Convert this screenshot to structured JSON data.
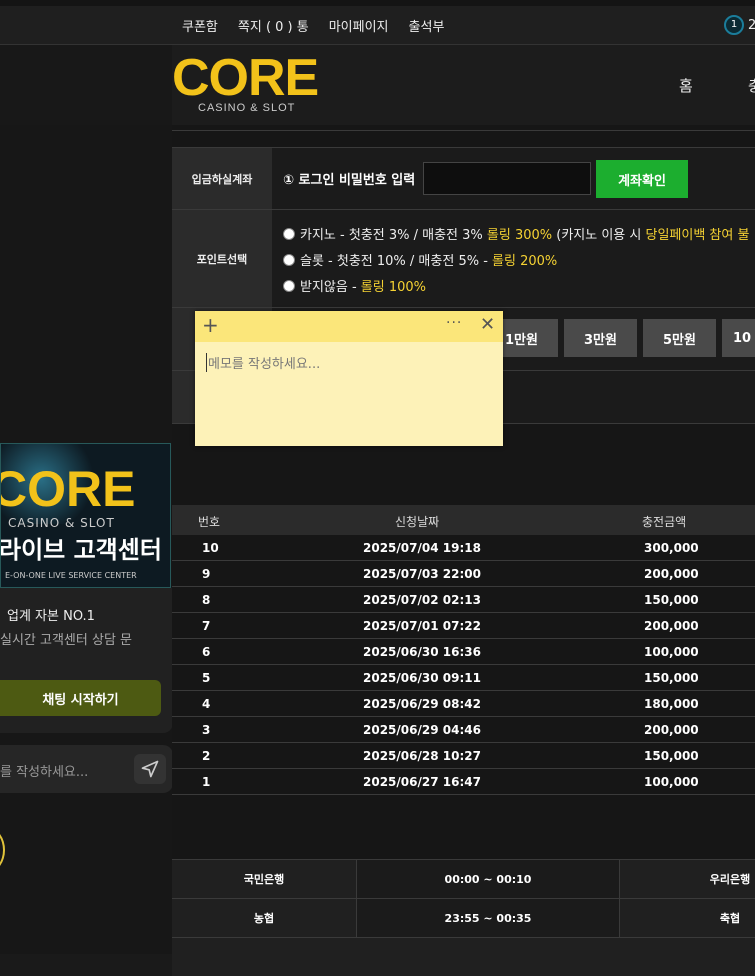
{
  "topnav": {
    "items": [
      "쿠폰함",
      "쪽지 ( 0 ) 통",
      "마이페이지",
      "출석부"
    ],
    "badge_count": "1",
    "right_text": "2"
  },
  "header": {
    "logo_text": "CORE",
    "logo_sub": "CASINO & SLOT",
    "nav": [
      "홈",
      "충"
    ]
  },
  "form": {
    "account_label": "입금하실계좌",
    "login_prompt": "① 로그인 비밀번호 입력",
    "password_value": "",
    "confirm_button": "계좌확인",
    "points_label": "포인트선택",
    "options": [
      {
        "prefix": "카지노 - 첫충전 3% / 매충전 3% ",
        "highlight": "롤링 300%",
        "suffix": " (카지노 이용 시 ",
        "highlight2": "당일페이백 참여 불"
      },
      {
        "prefix": "슬롯 - 첫충전 10% / 매충전 5% - ",
        "highlight": "롤링 200%"
      },
      {
        "prefix": "받지않음 - ",
        "highlight": "롤링 100%"
      }
    ],
    "amount_buttons": [
      "1만원",
      "3만원",
      "5만원",
      "10"
    ]
  },
  "memo": {
    "placeholder": "메모를 작성하세요..."
  },
  "sidebar": {
    "banner_logo": "CORE",
    "banner_sub": "CASINO & SLOT",
    "banner_kr": "라이브 고객센터",
    "banner_en": "E-ON-ONE LIVE SERVICE CENTER",
    "chat_title": "업계 자본 NO.1",
    "chat_desc": "실시간 고객센터 상담 문",
    "chat_button": "채팅 시작하기",
    "chat_placeholder": "를 작성하세요..."
  },
  "history": {
    "columns": [
      "번호",
      "신청날짜",
      "충전금액"
    ],
    "rows": [
      {
        "no": "10",
        "date": "2025/07/04 19:18",
        "amount": "300,000"
      },
      {
        "no": "9",
        "date": "2025/07/03 22:00",
        "amount": "200,000"
      },
      {
        "no": "8",
        "date": "2025/07/02 02:13",
        "amount": "150,000"
      },
      {
        "no": "7",
        "date": "2025/07/01 07:22",
        "amount": "200,000"
      },
      {
        "no": "6",
        "date": "2025/06/30 16:36",
        "amount": "100,000"
      },
      {
        "no": "5",
        "date": "2025/06/30 09:11",
        "amount": "150,000"
      },
      {
        "no": "4",
        "date": "2025/06/29 08:42",
        "amount": "180,000"
      },
      {
        "no": "3",
        "date": "2025/06/29 04:46",
        "amount": "200,000"
      },
      {
        "no": "2",
        "date": "2025/06/28 10:27",
        "amount": "150,000"
      },
      {
        "no": "1",
        "date": "2025/06/27 16:47",
        "amount": "100,000"
      }
    ]
  },
  "banks": [
    {
      "name": "국민은행",
      "time": "00:00 ~ 00:10",
      "name2": "우리은행"
    },
    {
      "name": "농협",
      "time": "23:55 ~ 00:35",
      "name2": "축협"
    }
  ],
  "colors": {
    "accent_green": "#1cae2f",
    "highlight_yellow": "#f5d233",
    "logo_gold": "#f2c21a"
  }
}
